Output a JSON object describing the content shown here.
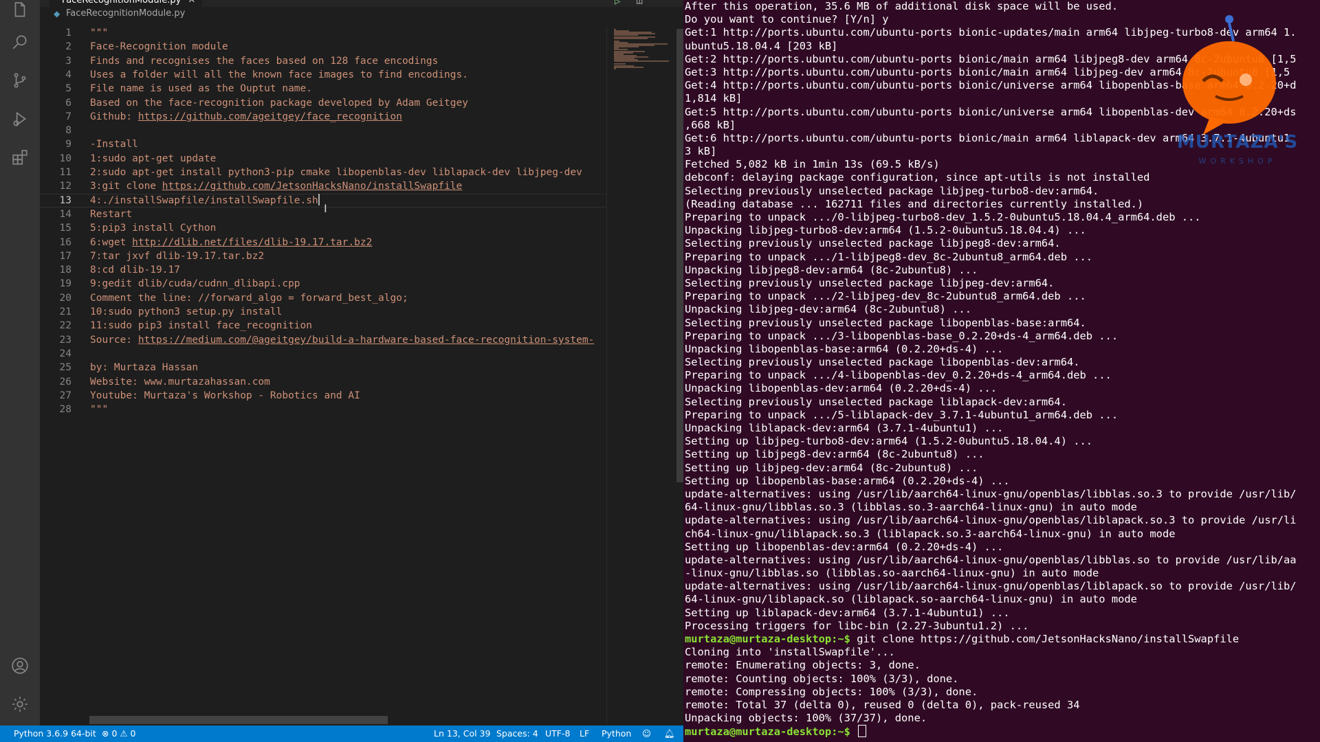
{
  "editor": {
    "tab_label": "FaceRecognitionModule.py",
    "breadcrumb": "FaceRecognitionModule.py",
    "current_line": 13,
    "lines": [
      {
        "n": "1",
        "text": "\"\"\""
      },
      {
        "n": "2",
        "text": "Face-Recognition module"
      },
      {
        "n": "3",
        "text": "Finds and recognises the faces based on 128 face encodings"
      },
      {
        "n": "4",
        "text": "Uses a folder will all the known face images to find encodings."
      },
      {
        "n": "5",
        "text": "File name is used as the Ouptut name."
      },
      {
        "n": "6",
        "text": "Based on the face-recognition package developed by Adam Geitgey"
      },
      {
        "n": "7",
        "prefix": "Github: ",
        "link": "https://github.com/ageitgey/face_recognition"
      },
      {
        "n": "8",
        "text": ""
      },
      {
        "n": "9",
        "text": "-Install"
      },
      {
        "n": "10",
        "text": "1:sudo apt-get update"
      },
      {
        "n": "11",
        "text": "2:sudo apt-get install python3-pip cmake libopenblas-dev liblapack-dev libjpeg-dev"
      },
      {
        "n": "12",
        "prefix": "3:git clone ",
        "link": "https://github.com/JetsonHacksNano/installSwapfile"
      },
      {
        "n": "13",
        "text": "4:./installSwapfile/installSwapfile.sh",
        "cursor": true
      },
      {
        "n": "14",
        "text": "Restart"
      },
      {
        "n": "15",
        "text": "5:pip3 install Cython"
      },
      {
        "n": "16",
        "prefix": "6:wget ",
        "link": "http://dlib.net/files/dlib-19.17.tar.bz2"
      },
      {
        "n": "17",
        "text": "7:tar jxvf dlib-19.17.tar.bz2"
      },
      {
        "n": "18",
        "text": "8:cd dlib-19.17"
      },
      {
        "n": "19",
        "text": "9:gedit dlib/cuda/cudnn_dlibapi.cpp"
      },
      {
        "n": "20",
        "text": "Comment the line: //forward_algo = forward_best_algo;"
      },
      {
        "n": "21",
        "text": "10:sudo python3 setup.py install"
      },
      {
        "n": "22",
        "text": "11:sudo pip3 install face_recognition"
      },
      {
        "n": "23",
        "prefix": "Source: ",
        "link": "https://medium.com/@ageitgey/build-a-hardware-based-face-recognition-system-"
      },
      {
        "n": "24",
        "text": ""
      },
      {
        "n": "25",
        "text": "by: Murtaza Hassan"
      },
      {
        "n": "26",
        "text": "Website: www.murtazahassan.com"
      },
      {
        "n": "27",
        "text": "Youtube: Murtaza's Workshop - Robotics and AI"
      },
      {
        "n": "28",
        "text": "\"\"\""
      }
    ]
  },
  "status_bar": {
    "interpreter": "Python 3.6.9 64-bit",
    "problems": "⊗ 0 ⚠ 0",
    "cursor_pos": "Ln 13, Col 39",
    "indent": "Spaces: 4",
    "encoding": "UTF-8",
    "eol": "LF",
    "language": "Python"
  },
  "terminal": {
    "lines": [
      "After this operation, 35.6 MB of additional disk space will be used.",
      "Do you want to continue? [Y/n] y",
      "Get:1 http://ports.ubuntu.com/ubuntu-ports bionic-updates/main arm64 libjpeg-turbo8-dev arm64 1.",
      "ubuntu5.18.04.4 [203 kB]",
      "Get:2 http://ports.ubuntu.com/ubuntu-ports bionic/main arm64 libjpeg8-dev arm64 8c-2ubuntu8 [1,5",
      "Get:3 http://ports.ubuntu.com/ubuntu-ports bionic/main arm64 libjpeg-dev arm64 8c-2ubuntu8 [1,5",
      "Get:4 http://ports.ubuntu.com/ubuntu-ports bionic/universe arm64 libopenblas-base arm64 0.2.20+d",
      "1,814 kB]",
      "Get:5 http://ports.ubuntu.com/ubuntu-ports bionic/universe arm64 libopenblas-dev arm64 0.2.20+ds",
      ",668 kB]",
      "Get:6 http://ports.ubuntu.com/ubuntu-ports bionic/main arm64 liblapack-dev arm64 3.7.1-4ubuntu1",
      "3 kB]",
      "Fetched 5,082 kB in 1min 13s (69.5 kB/s)",
      "debconf: delaying package configuration, since apt-utils is not installed",
      "Selecting previously unselected package libjpeg-turbo8-dev:arm64.",
      "(Reading database ... 162711 files and directories currently installed.)",
      "Preparing to unpack .../0-libjpeg-turbo8-dev_1.5.2-0ubuntu5.18.04.4_arm64.deb ...",
      "Unpacking libjpeg-turbo8-dev:arm64 (1.5.2-0ubuntu5.18.04.4) ...",
      "Selecting previously unselected package libjpeg8-dev:arm64.",
      "Preparing to unpack .../1-libjpeg8-dev_8c-2ubuntu8_arm64.deb ...",
      "Unpacking libjpeg8-dev:arm64 (8c-2ubuntu8) ...",
      "Selecting previously unselected package libjpeg-dev:arm64.",
      "Preparing to unpack .../2-libjpeg-dev_8c-2ubuntu8_arm64.deb ...",
      "Unpacking libjpeg-dev:arm64 (8c-2ubuntu8) ...",
      "Selecting previously unselected package libopenblas-base:arm64.",
      "Preparing to unpack .../3-libopenblas-base_0.2.20+ds-4_arm64.deb ...",
      "Unpacking libopenblas-base:arm64 (0.2.20+ds-4) ...",
      "Selecting previously unselected package libopenblas-dev:arm64.",
      "Preparing to unpack .../4-libopenblas-dev_0.2.20+ds-4_arm64.deb ...",
      "Unpacking libopenblas-dev:arm64 (0.2.20+ds-4) ...",
      "Selecting previously unselected package liblapack-dev:arm64.",
      "Preparing to unpack .../5-liblapack-dev_3.7.1-4ubuntu1_arm64.deb ...",
      "Unpacking liblapack-dev:arm64 (3.7.1-4ubuntu1) ...",
      "Setting up libjpeg-turbo8-dev:arm64 (1.5.2-0ubuntu5.18.04.4) ...",
      "Setting up libjpeg8-dev:arm64 (8c-2ubuntu8) ...",
      "Setting up libjpeg-dev:arm64 (8c-2ubuntu8) ...",
      "Setting up libopenblas-base:arm64 (0.2.20+ds-4) ...",
      "update-alternatives: using /usr/lib/aarch64-linux-gnu/openblas/libblas.so.3 to provide /usr/lib/",
      "64-linux-gnu/libblas.so.3 (libblas.so.3-aarch64-linux-gnu) in auto mode",
      "update-alternatives: using /usr/lib/aarch64-linux-gnu/openblas/liblapack.so.3 to provide /usr/li",
      "ch64-linux-gnu/liblapack.so.3 (liblapack.so.3-aarch64-linux-gnu) in auto mode",
      "Setting up libopenblas-dev:arm64 (0.2.20+ds-4) ...",
      "update-alternatives: using /usr/lib/aarch64-linux-gnu/openblas/libblas.so to provide /usr/lib/aa",
      "-linux-gnu/libblas.so (libblas.so-aarch64-linux-gnu) in auto mode",
      "update-alternatives: using /usr/lib/aarch64-linux-gnu/openblas/liblapack.so to provide /usr/lib/",
      "64-linux-gnu/liblapack.so (liblapack.so-aarch64-linux-gnu) in auto mode",
      "Setting up liblapack-dev:arm64 (3.7.1-4ubuntu1) ...",
      "Processing triggers for libc-bin (2.27-3ubuntu1.2) ...",
      {
        "prompt": "murtaza@murtaza-desktop:~$",
        "cmd": " git clone https://github.com/JetsonHacksNano/installSwapfile"
      },
      "Cloning into 'installSwapfile'...",
      "remote: Enumerating objects: 3, done.",
      "remote: Counting objects: 100% (3/3), done.",
      "remote: Compressing objects: 100% (3/3), done.",
      "remote: Total 37 (delta 0), reused 0 (delta 0), pack-reused 34",
      "Unpacking objects: 100% (37/37), done.",
      {
        "prompt": "murtaza@murtaza-desktop:~$",
        "cmd": " ",
        "cursor": true
      }
    ]
  },
  "watermark": {
    "text": "MURTAZA'S",
    "sub": "WORKSHOP"
  },
  "colors": {
    "terminal_bg": "#300a24",
    "status_bar": "#007acc",
    "string": "#ce9178",
    "prompt": "#8ae234",
    "logo": "#ff6a00"
  }
}
